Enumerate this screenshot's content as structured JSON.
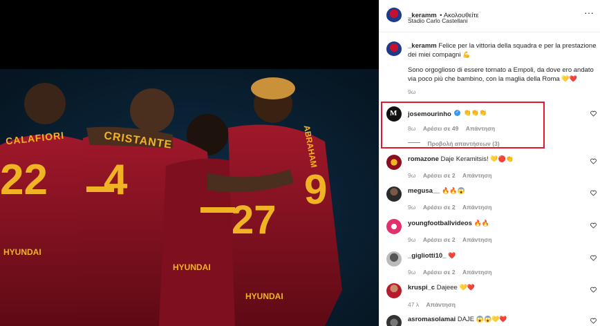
{
  "post": {
    "author": "_keramm",
    "follow_label": "Ακολουθείτε",
    "location": "Stadio Carlo Castellani",
    "caption_line1": "Felice per la vittoria della squadra e per la prestazione dei miei compagni",
    "caption_line1_emoji": "💪",
    "caption_line2": "Sono orgoglioso di essere tornato a Empoli, da dove ero andato via poco più che bambino, con la maglia della Roma",
    "caption_line2_emoji": "💛❤️",
    "caption_time": "9ω"
  },
  "photo": {
    "jersey_texts": [
      "CALAFIORI",
      "22",
      "CRISTANTE",
      "4",
      "ABRAHAM",
      "9",
      "27",
      "HYUNDAI",
      "HYUNDAI",
      "HYUNDAI"
    ]
  },
  "comments": [
    {
      "user": "josemourinho",
      "verified": true,
      "text": "",
      "emoji": "👏👏👏",
      "time": "8ω",
      "likes": "Αρέσει σε 49",
      "reply": "Απάντηση",
      "view_replies": "Προβολή απαντήσεων (3)"
    },
    {
      "user": "romazone",
      "text": "Daje Keramitsis!",
      "emoji": "💛🔴👏",
      "time": "9ω",
      "likes": "Αρέσει σε 2",
      "reply": "Απάντηση"
    },
    {
      "user": "megusa__",
      "text": "",
      "emoji": "🔥🔥😱",
      "time": "9ω",
      "likes": "Αρέσει σε 2",
      "reply": "Απάντηση"
    },
    {
      "user": "youngfootballvideos",
      "text": "",
      "emoji": "🔥🔥",
      "time": "9ω",
      "likes": "Αρέσει σε 2",
      "reply": "Απάντηση"
    },
    {
      "user": "_gigliotti10_",
      "text": "",
      "emoji": "❤️",
      "time": "9ω",
      "likes": "Αρέσει σε 2",
      "reply": "Απάντηση"
    },
    {
      "user": "kruspi_c",
      "text": "Dajeee",
      "emoji": "💛❤️",
      "time": "47 λ",
      "likes": "",
      "reply": "Απάντηση"
    },
    {
      "user": "asromasolamai",
      "text": "DAJE",
      "emoji": "😱😱💛❤️",
      "time": "",
      "likes": "",
      "reply": ""
    }
  ],
  "colors": {
    "highlight": "#e0182d",
    "roma_red": "#8b0d1e",
    "gold": "#f0b323"
  }
}
